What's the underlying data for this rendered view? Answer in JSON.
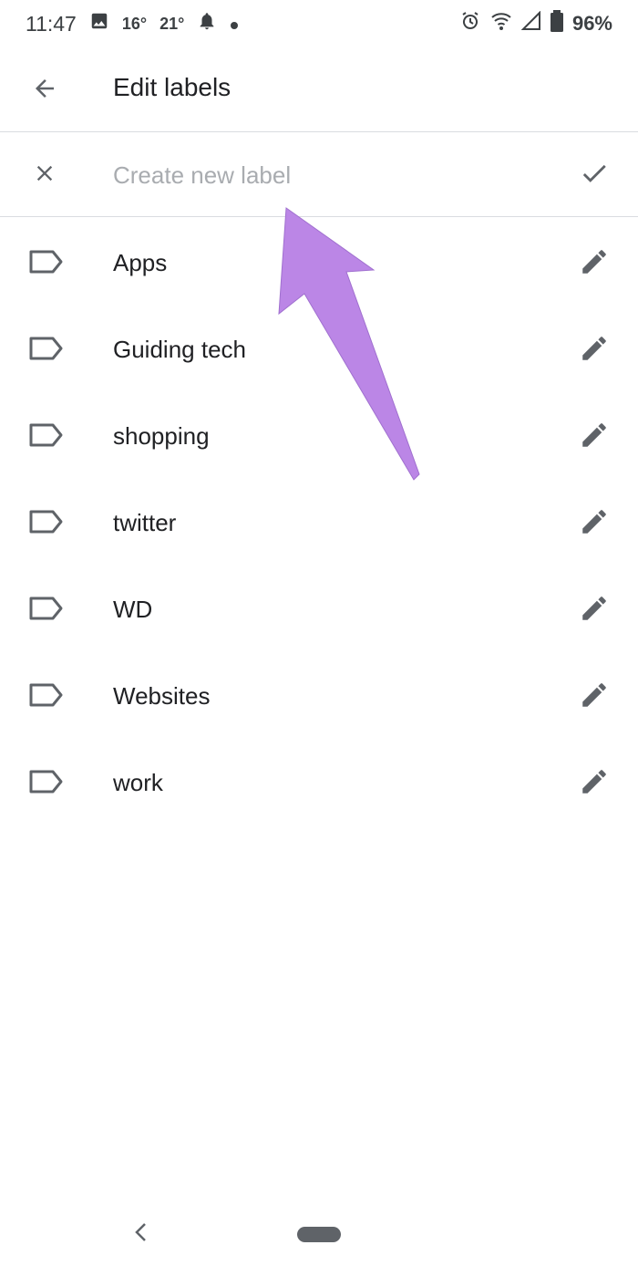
{
  "status_bar": {
    "time": "11:47",
    "temp_low": "16°",
    "temp_high": "21°",
    "battery": "96%"
  },
  "app_bar": {
    "title": "Edit labels"
  },
  "create_label": {
    "placeholder": "Create new label",
    "value": ""
  },
  "labels": [
    {
      "name": "Apps"
    },
    {
      "name": "Guiding tech"
    },
    {
      "name": "shopping"
    },
    {
      "name": "twitter"
    },
    {
      "name": "WD"
    },
    {
      "name": "Websites"
    },
    {
      "name": "work"
    }
  ],
  "icons": {
    "back": "arrow-back-icon",
    "cancel": "close-icon",
    "confirm": "check-icon",
    "label": "label-outline-icon",
    "edit": "pencil-icon"
  },
  "colors": {
    "icon": "#5f6368",
    "text": "#202124",
    "placeholder": "#a9acb0",
    "divider": "#dadce0",
    "annotation_arrow": "#bb86e6"
  }
}
